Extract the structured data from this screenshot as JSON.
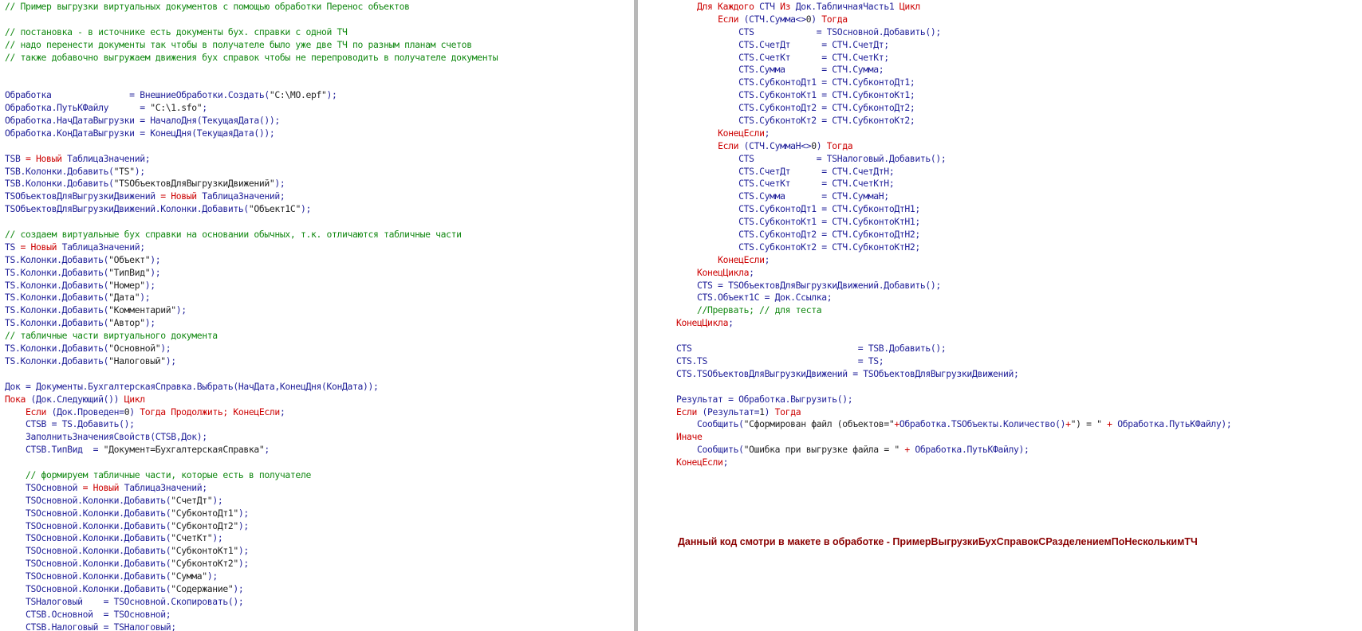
{
  "colors": {
    "keyword": "#cc0000",
    "comment": "#118811",
    "identifier": "#1f1f99",
    "string": "#222222",
    "note": "#8b0000"
  },
  "left_lines": [
    [
      [
        "c",
        "// Пример выгрузки виртуальных документов с помощью обработки Перенос объектов"
      ]
    ],
    [],
    [
      [
        "c",
        "// постановка - в источнике есть документы бух. справки с одной ТЧ"
      ]
    ],
    [
      [
        "c",
        "// надо перенести документы так чтобы в получателе было уже две ТЧ по разным планам счетов"
      ]
    ],
    [
      [
        "c",
        "// также добавочно выгружаем движения бух справок чтобы не перепроводить в получателе документы"
      ]
    ],
    [],
    [],
    [
      [
        "i",
        "Обработка               = ВнешниеОбработки.Создать("
      ],
      [
        "s",
        "\"C:\\MO.epf\""
      ],
      [
        "i",
        ");"
      ]
    ],
    [
      [
        "i",
        "Обработка.ПутьКФайлу      = "
      ],
      [
        "s",
        "\"C:\\1.sfo\""
      ],
      [
        "i",
        ";"
      ]
    ],
    [
      [
        "i",
        "Обработка.НачДатаВыгрузки = НачалоДня(ТекущаяДата());"
      ]
    ],
    [
      [
        "i",
        "Обработка.КонДатаВыгрузки = КонецДня(ТекущаяДата());"
      ]
    ],
    [],
    [
      [
        "i",
        "TSB "
      ],
      [
        "k",
        "= Новый "
      ],
      [
        "i",
        "ТаблицаЗначений;"
      ]
    ],
    [
      [
        "i",
        "TSB.Колонки.Добавить("
      ],
      [
        "s",
        "\"TS\""
      ],
      [
        "i",
        ");"
      ]
    ],
    [
      [
        "i",
        "TSB.Колонки.Добавить("
      ],
      [
        "s",
        "\"TSОбъектовДляВыгрузкиДвижений\""
      ],
      [
        "i",
        ");"
      ]
    ],
    [
      [
        "i",
        "TSОбъектовДляВыгрузкиДвижений "
      ],
      [
        "k",
        "= Новый "
      ],
      [
        "i",
        "ТаблицаЗначений;"
      ]
    ],
    [
      [
        "i",
        "TSОбъектовДляВыгрузкиДвижений.Колонки.Добавить("
      ],
      [
        "s",
        "\"Объект1С\""
      ],
      [
        "i",
        ");"
      ]
    ],
    [],
    [
      [
        "c",
        "// создаем виртуальные бух справки на основании обычных, т.к. отличаются табличные части"
      ]
    ],
    [
      [
        "i",
        "TS "
      ],
      [
        "k",
        "= Новый "
      ],
      [
        "i",
        "ТаблицаЗначений;"
      ]
    ],
    [
      [
        "i",
        "TS.Колонки.Добавить("
      ],
      [
        "s",
        "\"Объект\""
      ],
      [
        "i",
        ");"
      ]
    ],
    [
      [
        "i",
        "TS.Колонки.Добавить("
      ],
      [
        "s",
        "\"ТипВид\""
      ],
      [
        "i",
        ");"
      ]
    ],
    [
      [
        "i",
        "TS.Колонки.Добавить("
      ],
      [
        "s",
        "\"Номер\""
      ],
      [
        "i",
        ");"
      ]
    ],
    [
      [
        "i",
        "TS.Колонки.Добавить("
      ],
      [
        "s",
        "\"Дата\""
      ],
      [
        "i",
        ");"
      ]
    ],
    [
      [
        "i",
        "TS.Колонки.Добавить("
      ],
      [
        "s",
        "\"Комментарий\""
      ],
      [
        "i",
        ");"
      ]
    ],
    [
      [
        "i",
        "TS.Колонки.Добавить("
      ],
      [
        "s",
        "\"Автор\""
      ],
      [
        "i",
        ");"
      ]
    ],
    [
      [
        "c",
        "// табличные части виртуального документа"
      ]
    ],
    [
      [
        "i",
        "TS.Колонки.Добавить("
      ],
      [
        "s",
        "\"Основной\""
      ],
      [
        "i",
        ");"
      ]
    ],
    [
      [
        "i",
        "TS.Колонки.Добавить("
      ],
      [
        "s",
        "\"Налоговый\""
      ],
      [
        "i",
        ");"
      ]
    ],
    [],
    [
      [
        "i",
        "Док = Документы.БухгалтерскаяСправка.Выбрать(НачДата,КонецДня(КонДата));"
      ]
    ],
    [
      [
        "k",
        "Пока "
      ],
      [
        "i",
        "(Док.Следующий()) "
      ],
      [
        "k",
        "Цикл"
      ]
    ],
    [
      [
        "i",
        "    "
      ],
      [
        "k",
        "Если "
      ],
      [
        "i",
        "(Док.Проведен="
      ],
      [
        "n",
        "0"
      ],
      [
        "i",
        ") "
      ],
      [
        "k",
        "Тогда Продолжить; КонецЕсли"
      ],
      [
        "i",
        ";"
      ]
    ],
    [
      [
        "i",
        "    CTSB = TS.Добавить();"
      ]
    ],
    [
      [
        "i",
        "    ЗаполнитьЗначенияСвойств(CTSB,Док);"
      ]
    ],
    [
      [
        "i",
        "    CTSB.ТипВид  = "
      ],
      [
        "s",
        "\"Документ=БухгалтерскаяСправка\""
      ],
      [
        "i",
        ";"
      ]
    ],
    [],
    [
      [
        "c",
        "    // формируем табличные части, которые есть в получателе"
      ]
    ],
    [
      [
        "i",
        "    TSОсновной "
      ],
      [
        "k",
        "= Новый "
      ],
      [
        "i",
        "ТаблицаЗначений;"
      ]
    ],
    [
      [
        "i",
        "    TSОсновной.Колонки.Добавить("
      ],
      [
        "s",
        "\"СчетДт\""
      ],
      [
        "i",
        ");"
      ]
    ],
    [
      [
        "i",
        "    TSОсновной.Колонки.Добавить("
      ],
      [
        "s",
        "\"СубконтоДт1\""
      ],
      [
        "i",
        ");"
      ]
    ],
    [
      [
        "i",
        "    TSОсновной.Колонки.Добавить("
      ],
      [
        "s",
        "\"СубконтоДт2\""
      ],
      [
        "i",
        ");"
      ]
    ],
    [
      [
        "i",
        "    TSОсновной.Колонки.Добавить("
      ],
      [
        "s",
        "\"СчетКт\""
      ],
      [
        "i",
        ");"
      ]
    ],
    [
      [
        "i",
        "    TSОсновной.Колонки.Добавить("
      ],
      [
        "s",
        "\"СубконтоКт1\""
      ],
      [
        "i",
        ");"
      ]
    ],
    [
      [
        "i",
        "    TSОсновной.Колонки.Добавить("
      ],
      [
        "s",
        "\"СубконтоКт2\""
      ],
      [
        "i",
        ");"
      ]
    ],
    [
      [
        "i",
        "    TSОсновной.Колонки.Добавить("
      ],
      [
        "s",
        "\"Сумма\""
      ],
      [
        "i",
        ");"
      ]
    ],
    [
      [
        "i",
        "    TSОсновной.Колонки.Добавить("
      ],
      [
        "s",
        "\"Содержание\""
      ],
      [
        "i",
        ");"
      ]
    ],
    [
      [
        "i",
        "    TSНалоговый    = TSОсновной.Скопировать();"
      ]
    ],
    [
      [
        "i",
        "    CTSB.Основной  = TSОсновной;"
      ]
    ],
    [
      [
        "i",
        "    CTSB.Налоговый = TSНалоговый;"
      ]
    ]
  ],
  "right_lines": [
    [
      [
        "i",
        "    "
      ],
      [
        "k",
        "Для Каждого "
      ],
      [
        "i",
        "СТЧ "
      ],
      [
        "k",
        "Из "
      ],
      [
        "i",
        "Док.ТабличнаяЧасть1 "
      ],
      [
        "k",
        "Цикл"
      ]
    ],
    [
      [
        "i",
        "        "
      ],
      [
        "k",
        "Если "
      ],
      [
        "i",
        "(СТЧ.Сумма<>"
      ],
      [
        "n",
        "0"
      ],
      [
        "i",
        ") "
      ],
      [
        "k",
        "Тогда"
      ]
    ],
    [
      [
        "i",
        "            CTS            = TSОсновной.Добавить();"
      ]
    ],
    [
      [
        "i",
        "            CTS.СчетДт      = СТЧ.СчетДт;"
      ]
    ],
    [
      [
        "i",
        "            CTS.СчетКт      = СТЧ.СчетКт;"
      ]
    ],
    [
      [
        "i",
        "            CTS.Сумма       = СТЧ.Сумма;"
      ]
    ],
    [
      [
        "i",
        "            CTS.СубконтоДт1 = СТЧ.СубконтоДт1;"
      ]
    ],
    [
      [
        "i",
        "            CTS.СубконтоКт1 = СТЧ.СубконтоКт1;"
      ]
    ],
    [
      [
        "i",
        "            CTS.СубконтоДт2 = СТЧ.СубконтоДт2;"
      ]
    ],
    [
      [
        "i",
        "            CTS.СубконтоКт2 = СТЧ.СубконтоКт2;"
      ]
    ],
    [
      [
        "i",
        "        "
      ],
      [
        "k",
        "КонецЕсли"
      ],
      [
        "i",
        ";"
      ]
    ],
    [
      [
        "i",
        "        "
      ],
      [
        "k",
        "Если "
      ],
      [
        "i",
        "(СТЧ.СуммаН<>"
      ],
      [
        "n",
        "0"
      ],
      [
        "i",
        ") "
      ],
      [
        "k",
        "Тогда"
      ]
    ],
    [
      [
        "i",
        "            CTS            = TSНалоговый.Добавить();"
      ]
    ],
    [
      [
        "i",
        "            CTS.СчетДт      = СТЧ.СчетДтН;"
      ]
    ],
    [
      [
        "i",
        "            CTS.СчетКт      = СТЧ.СчетКтН;"
      ]
    ],
    [
      [
        "i",
        "            CTS.Сумма       = СТЧ.СуммаН;"
      ]
    ],
    [
      [
        "i",
        "            CTS.СубконтоДт1 = СТЧ.СубконтоДтН1;"
      ]
    ],
    [
      [
        "i",
        "            CTS.СубконтоКт1 = СТЧ.СубконтоКтН1;"
      ]
    ],
    [
      [
        "i",
        "            CTS.СубконтоДт2 = СТЧ.СубконтоДтН2;"
      ]
    ],
    [
      [
        "i",
        "            CTS.СубконтоКт2 = СТЧ.СубконтоКтН2;"
      ]
    ],
    [
      [
        "i",
        "        "
      ],
      [
        "k",
        "КонецЕсли"
      ],
      [
        "i",
        ";"
      ]
    ],
    [
      [
        "i",
        "    "
      ],
      [
        "k",
        "КонецЦикла"
      ],
      [
        "i",
        ";"
      ]
    ],
    [
      [
        "i",
        "    CTS = TSОбъектовДляВыгрузкиДвижений.Добавить();"
      ]
    ],
    [
      [
        "i",
        "    CTS.Объект1С = Док.Ссылка;"
      ]
    ],
    [
      [
        "c",
        "    //Прервать; // для теста"
      ]
    ],
    [
      [
        "k",
        "КонецЦикла"
      ],
      [
        "i",
        ";"
      ]
    ],
    [],
    [
      [
        "i",
        "CTS                                = TSB.Добавить();"
      ]
    ],
    [
      [
        "i",
        "CTS.TS                             = TS;"
      ]
    ],
    [
      [
        "i",
        "CTS.TSОбъектовДляВыгрузкиДвижений = TSОбъектовДляВыгрузкиДвижений;"
      ]
    ],
    [],
    [
      [
        "i",
        "Результат = Обработка.Выгрузить();"
      ]
    ],
    [
      [
        "k",
        "Если "
      ],
      [
        "i",
        "(Результат="
      ],
      [
        "n",
        "1"
      ],
      [
        "i",
        ") "
      ],
      [
        "k",
        "Тогда"
      ]
    ],
    [
      [
        "i",
        "    Сообщить("
      ],
      [
        "s",
        "\"Сформирован файл (объектов=\""
      ],
      [
        "k",
        "+"
      ],
      [
        "i",
        "Обработка.TSОбъекты.Количество()"
      ],
      [
        "k",
        "+"
      ],
      [
        "s",
        "\") = \""
      ],
      [
        "k",
        " + "
      ],
      [
        "i",
        "Обработка.ПутьКФайлу);"
      ]
    ],
    [
      [
        "k",
        "Иначе"
      ]
    ],
    [
      [
        "i",
        "    Сообщить("
      ],
      [
        "s",
        "\"Ошибка при выгрузке файла = \""
      ],
      [
        "k",
        " + "
      ],
      [
        "i",
        "Обработка.ПутьКФайлу);"
      ]
    ],
    [
      [
        "k",
        "КонецЕсли"
      ],
      [
        "i",
        ";"
      ]
    ]
  ],
  "note": "Данный код смотри в макете в обработке - ПримерВыгрузкиБухСправокСРазделениемПоНесколькимТЧ"
}
